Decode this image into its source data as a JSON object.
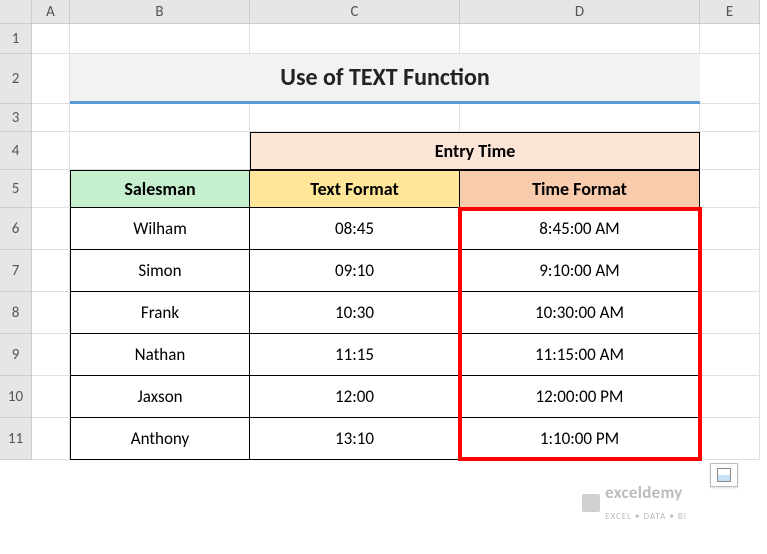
{
  "columns": [
    "A",
    "B",
    "C",
    "D",
    "E"
  ],
  "rows": [
    "1",
    "2",
    "3",
    "4",
    "5",
    "6",
    "7",
    "8",
    "9",
    "10",
    "11"
  ],
  "title": "Use of TEXT Function",
  "headers": {
    "entry_time": "Entry Time",
    "salesman": "Salesman",
    "text_format": "Text Format",
    "time_format": "Time Format"
  },
  "data": [
    {
      "name": "Wilham",
      "text": "08:45",
      "time": "8:45:00 AM"
    },
    {
      "name": "Simon",
      "text": "09:10",
      "time": "9:10:00 AM"
    },
    {
      "name": "Frank",
      "text": "10:30",
      "time": "10:30:00 AM"
    },
    {
      "name": "Nathan",
      "text": "11:15",
      "time": "11:15:00 AM"
    },
    {
      "name": "Jaxson",
      "text": "12:00",
      "time": "12:00:00 PM"
    },
    {
      "name": "Anthony",
      "text": "13:10",
      "time": "1:10:00 PM"
    }
  ],
  "watermark": {
    "brand": "exceldemy",
    "tagline": "EXCEL • DATA • BI"
  }
}
